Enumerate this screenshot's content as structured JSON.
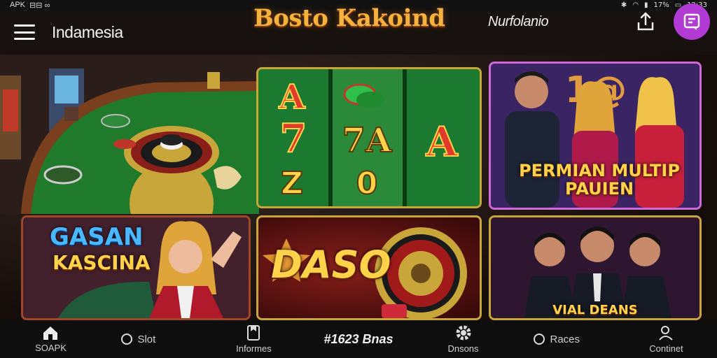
{
  "status_bar": {
    "left_text": "APK",
    "left_icons": "⊟⊟ ∞",
    "right_text": "17%",
    "time": "12:33"
  },
  "app_bar": {
    "region": "Indamesia",
    "brand": "Bosto Kakoind",
    "username": "Nurfolanio"
  },
  "tiles": {
    "multiplayer_caption": "PERMIAN MULTIP PAUIEN",
    "casino_caption_top": "GASAN",
    "casino_caption_bottom": "KASCINA",
    "daso_caption": "DASO",
    "vial_caption": "VIAL DEANS",
    "slot_symbols": [
      "A",
      "☘",
      "",
      "7",
      "7A",
      "A",
      "Z",
      "0",
      ""
    ]
  },
  "bottom_nav": {
    "home_label": "SOAPK",
    "slot_label": "Slot",
    "info_label": "Informes",
    "center_label": "#1623 Bnas",
    "settings_label": "Dnsons",
    "races_label": "Races",
    "contact_label": "Continet"
  },
  "colors": {
    "accent": "#b23bd6",
    "brand_gold": "#f5b23c",
    "felt_green": "#1f7a2c",
    "bar_bg": "#17120f"
  }
}
